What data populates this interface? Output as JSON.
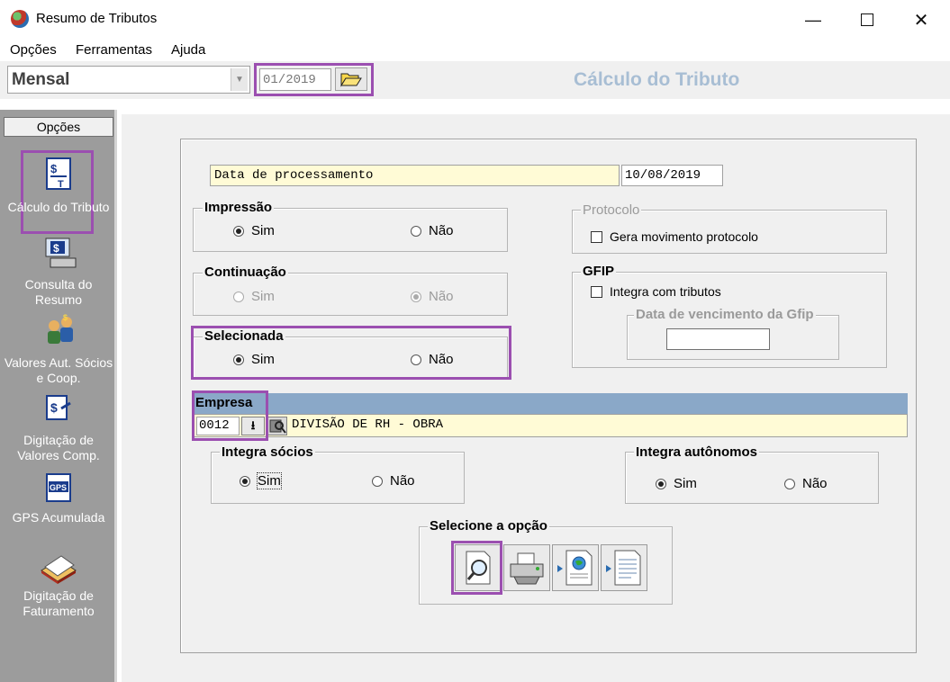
{
  "window": {
    "title": "Resumo de Tributos",
    "min": "—",
    "max": "☐",
    "close": "✕"
  },
  "menu": {
    "items": [
      "Opções",
      "Ferramentas",
      "Ajuda"
    ]
  },
  "toolbar": {
    "period": "Mensal",
    "reference_date": "01/2019",
    "screen_title": "Cálculo do Tributo"
  },
  "sidebar": {
    "header": "Opções",
    "items": [
      {
        "label": "Cálculo do Tributo",
        "icon": "tax-calc-icon"
      },
      {
        "label": "Consulta do Resumo",
        "icon": "computer-query-icon"
      },
      {
        "label": "Valores Aut. Sócios e Coop.",
        "icon": "partners-icon"
      },
      {
        "label": "Digitação de Valores Comp.",
        "icon": "entry-values-icon"
      },
      {
        "label": "GPS Acumulada",
        "icon": "gps-icon"
      },
      {
        "label": "Digitação de Faturamento",
        "icon": "billing-icon"
      }
    ]
  },
  "form": {
    "processing_label": "Data de processamento",
    "processing_date": "10/08/2019",
    "impressao": {
      "title": "Impressão",
      "yes": "Sim",
      "no": "Não",
      "selected": "Sim"
    },
    "continuacao": {
      "title": "Continuação",
      "yes": "Sim",
      "no": "Não",
      "selected": "Não"
    },
    "selecionada": {
      "title": "Selecionada",
      "yes": "Sim",
      "no": "Não",
      "selected": "Sim"
    },
    "protocolo": {
      "title": "Protocolo",
      "checkbox": "Gera movimento protocolo"
    },
    "gfip": {
      "title": "GFIP",
      "checkbox": "Integra com tributos",
      "due_title": "Data de vencimento da Gfip",
      "due_value": ""
    },
    "empresa": {
      "title": "Empresa",
      "code": "0012",
      "name": "DIVISÃO DE RH - OBRA"
    },
    "integra_socios": {
      "title": "Integra sócios",
      "yes": "Sim",
      "no": "Não",
      "selected": "Sim"
    },
    "integra_autonomos": {
      "title": "Integra autônomos",
      "yes": "Sim",
      "no": "Não",
      "selected": "Sim"
    },
    "selecione": {
      "title": "Selecione a opção"
    }
  },
  "colors": {
    "highlight": "#9b4fb0",
    "title_blue": "#a8bed4",
    "empresa_bar": "#8aa8c8",
    "yellow_field": "#fffbd6"
  }
}
